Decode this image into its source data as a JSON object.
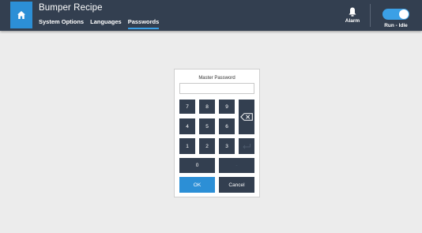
{
  "header": {
    "title": "Bumper Recipe",
    "home_icon": "home-icon",
    "tabs": [
      {
        "label": "System Options",
        "active": false
      },
      {
        "label": "Languages",
        "active": false
      },
      {
        "label": "Passwords",
        "active": true
      }
    ],
    "alarm": {
      "label": "Alarm",
      "icon": "bell-icon"
    },
    "run_mode": {
      "label": "Run - Idle",
      "on": true
    }
  },
  "dialog": {
    "title": "Master Password",
    "password_value": "",
    "keys": {
      "k7": "7",
      "k8": "8",
      "k9": "9",
      "k4": "4",
      "k5": "5",
      "k6": "6",
      "k1": "1",
      "k2": "2",
      "k3": "3",
      "k0": "0"
    },
    "backspace_icon": "backspace-icon",
    "enter_icon": "enter-icon",
    "minus_label": "-",
    "ok_label": "OK",
    "cancel_label": "Cancel"
  },
  "colors": {
    "header_bg": "#333f50",
    "accent": "#2c8fd6",
    "page_bg": "#ececec",
    "key_bg": "#333f50"
  }
}
